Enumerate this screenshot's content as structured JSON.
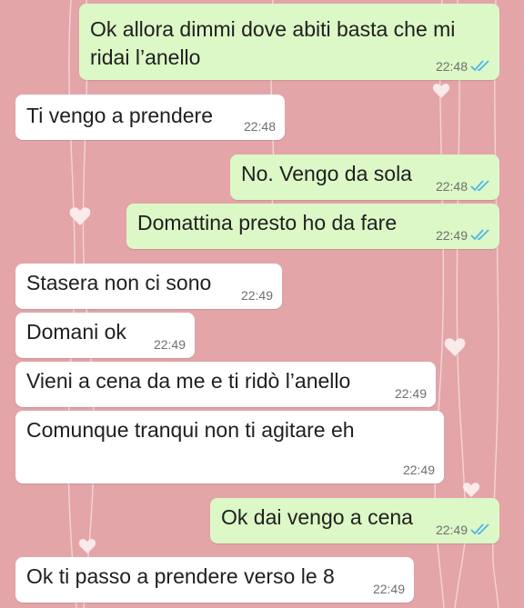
{
  "theme": {
    "wallpaper_color": "#e3a5a8",
    "incoming_bubble": "#ffffff",
    "outgoing_bubble": "#dcf8c6",
    "read_tick_color": "#4fb6ec"
  },
  "messages": [
    {
      "direction": "out",
      "lines": [
        "Ok allora dimmi dove abiti basta che mi",
        "ridai l’anello"
      ],
      "time": "22:48",
      "status_icon": "double-check-read-icon"
    },
    {
      "direction": "in",
      "lines": [
        "Ti vengo a prendere"
      ],
      "time": "22:48"
    },
    {
      "direction": "out",
      "lines": [
        "No. Vengo da sola"
      ],
      "time": "22:48",
      "status_icon": "double-check-read-icon"
    },
    {
      "direction": "out",
      "lines": [
        "Domattina presto ho da fare"
      ],
      "time": "22:49",
      "status_icon": "double-check-read-icon"
    },
    {
      "direction": "in",
      "lines": [
        "Stasera non ci sono"
      ],
      "time": "22:49"
    },
    {
      "direction": "in",
      "lines": [
        "Domani ok"
      ],
      "time": "22:49"
    },
    {
      "direction": "in",
      "lines": [
        "Vieni a cena da me e ti ridò l’anello"
      ],
      "time": "22:49"
    },
    {
      "direction": "in",
      "lines": [
        "Comunque tranqui non ti agitare eh"
      ],
      "time": "22:49"
    },
    {
      "direction": "out",
      "lines": [
        "Ok dai vengo a cena"
      ],
      "time": "22:49",
      "status_icon": "double-check-read-icon"
    },
    {
      "direction": "in",
      "lines": [
        "Ok ti passo a prendere verso le 8"
      ],
      "time": "22:49"
    }
  ]
}
